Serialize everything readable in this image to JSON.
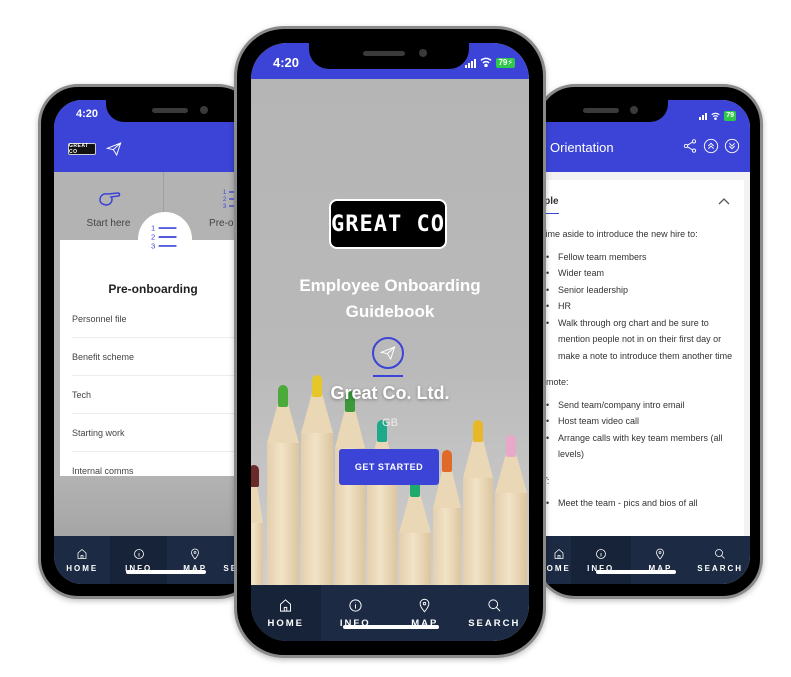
{
  "colors": {
    "brand_blue": "#3b44d6",
    "nav_bg": "#1c2a44",
    "battery_green": "#2fc84a"
  },
  "status_bar": {
    "time": "4:20",
    "battery": "79"
  },
  "bottom_nav": {
    "items": [
      {
        "label": "HOME",
        "icon": "home-icon"
      },
      {
        "label": "INFO",
        "icon": "info-icon"
      },
      {
        "label": "MAP",
        "icon": "map-pin-icon"
      },
      {
        "label": "SEARCH",
        "icon": "search-icon"
      }
    ],
    "active": "INFO"
  },
  "left_phone": {
    "logo_text": "GREAT CO",
    "tiles": [
      {
        "label": "Start here",
        "icon": "pointing-hand-icon"
      },
      {
        "label": "Pre-onboarding",
        "icon": "numbered-list-icon"
      }
    ],
    "sheet": {
      "title": "Pre-onboarding",
      "items": [
        "Personnel file",
        "Benefit scheme",
        "Tech",
        "Starting work",
        "Internal comms"
      ]
    }
  },
  "center_phone": {
    "logo_text": "GREAT CO",
    "title_line1": "Employee Onboarding",
    "title_line2": "Guidebook",
    "company": "Great Co. Ltd.",
    "country": "GB",
    "cta": "GET STARTED"
  },
  "right_phone": {
    "title": "Orientation",
    "section_heading": "ople",
    "intro": "t time aside to introduce the new hire to:",
    "list1": [
      "Fellow team members",
      "Wider team",
      "Senior leadership",
      "HR",
      "Walk through org chart and be sure to mention people not in on their first day or make a note to introduce them another time"
    ],
    "remote_label": "remote:",
    "list2": [
      "Send team/company intro email",
      "Host team video call",
      "Arrange calls with key team members (all levels)"
    ],
    "lt_label": "LT:",
    "list3": [
      "Meet the team - pics and bios of all"
    ]
  }
}
